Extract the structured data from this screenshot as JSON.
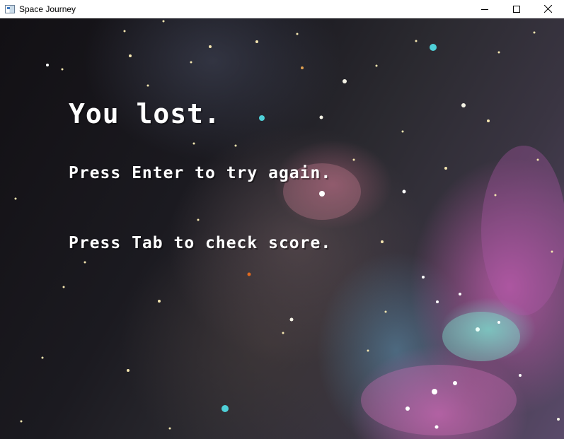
{
  "window": {
    "title": "Space Journey",
    "controls": {
      "minimize_icon": "minimize-icon",
      "maximize_icon": "maximize-icon",
      "close_icon": "close-icon"
    }
  },
  "game": {
    "title": "You lost.",
    "retry_prompt": "Press Enter to try again.",
    "score_prompt": "Press Tab to check score."
  },
  "colors": {
    "text": "#ffffff",
    "titlebar": "#ffffff"
  }
}
